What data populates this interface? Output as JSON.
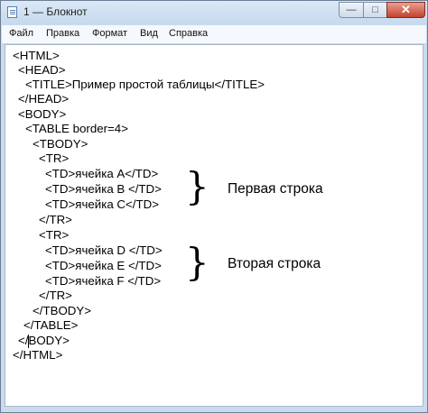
{
  "window": {
    "title": "1 — Блокнот",
    "buttons": {
      "minimize": "—",
      "maximize": "□",
      "close": "✕"
    }
  },
  "menu": [
    "Файл",
    "Правка",
    "Формат",
    "Вид",
    "Справка"
  ],
  "code": [
    "<HTML>",
    "<HEAD>",
    "<TITLE>Пример простой таблицы</TITLE>",
    "</HEAD>",
    "<BODY>",
    "<TABLE border=4>",
    "<TBODY>",
    "<TR>",
    "<TD>ячейка A</TD>",
    "<TD>ячейка B </TD>",
    "<TD>ячейка C</TD>",
    "</TR>",
    "<TR>",
    "<TD>ячейка D </TD>",
    "<TD>ячейка E </TD>",
    "<TD>ячейка F </TD>",
    "</TR>",
    "</TBODY>",
    "</TABLE>",
    "</BODY>",
    "</HTML>"
  ],
  "annotations": {
    "brace": "}",
    "row1": "Первая строка",
    "row2": "Вторая строка"
  }
}
